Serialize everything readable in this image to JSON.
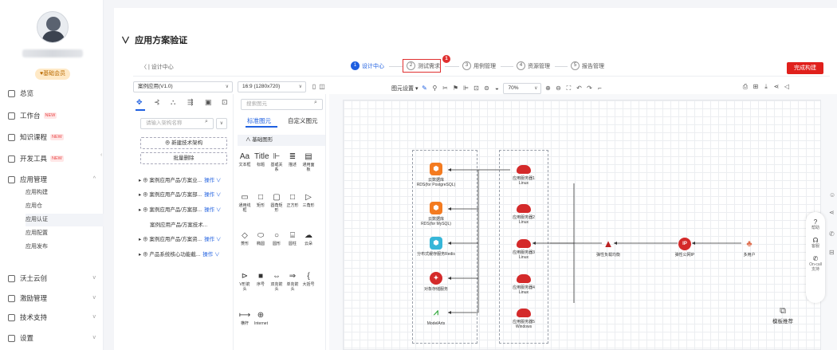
{
  "sidebar": {
    "member_badge": "♥基础会员",
    "items": [
      {
        "label": "总览",
        "icon": "overview-icon",
        "new": "",
        "chev": ""
      },
      {
        "label": "工作台",
        "icon": "workbench-icon",
        "new": "NEW",
        "chev": ""
      },
      {
        "label": "知识课程",
        "icon": "course-icon",
        "new": "NEW",
        "chev": ""
      },
      {
        "label": "开发工具",
        "icon": "devtools-icon",
        "new": "NEW",
        "chev": ""
      },
      {
        "label": "应用管理",
        "icon": "app-manage-icon",
        "new": "",
        "chev": "^"
      },
      {
        "label": "沃土云创",
        "icon": "cloud-create-icon",
        "new": "",
        "chev": "v"
      },
      {
        "label": "激励管理",
        "icon": "incentive-icon",
        "new": "",
        "chev": "v"
      },
      {
        "label": "技术支持",
        "icon": "support-icon",
        "new": "",
        "chev": "v"
      },
      {
        "label": "设置",
        "icon": "settings-icon",
        "new": "",
        "chev": "v"
      }
    ],
    "sub_items": [
      "应用构建",
      "应用仓",
      "应用认证",
      "应用配置",
      "应用发布"
    ],
    "collapse": "‹"
  },
  "page": {
    "title": "应用方案验证",
    "title_chev": "∨"
  },
  "topbar": {
    "back": "〈 | 设计中心",
    "steps": [
      {
        "num": "1",
        "label": "设计中心"
      },
      {
        "num": "2",
        "label": "测试需求"
      },
      {
        "num": "3",
        "label": "用例管理"
      },
      {
        "num": "4",
        "label": "资源管理"
      },
      {
        "num": "5",
        "label": "报告管理"
      }
    ],
    "highlight_count": "1",
    "finish_button": "完成构建"
  },
  "left_panel": {
    "project_select": "案例应用(V1.0)",
    "search_placeholder": "请输入架构名称",
    "new_arch_button": "⊕ 新建技术架构",
    "batch_delete_button": "批量删除",
    "op_label": "操作 ∨",
    "tree": [
      "▸ ⊕ 案例应用产品/方案业...",
      "▸ ⊕ 案例应用产品/方案部...",
      "▸ ⊕ 案例应用产品/方案部...",
      "案例应用产品/方案技术...",
      "▸ ⊕ 案例应用产品/方案资...",
      "▸ ⊕ 产品系统核心功能截..."
    ]
  },
  "shape_panel": {
    "size_select": "16:9 (1280x720)",
    "search_placeholder": "搜索图元",
    "tabs": [
      "标准图元",
      "自定义图元"
    ],
    "section": "∧  基础图形",
    "shapes_row1": [
      {
        "g": "Aa",
        "l": "文本框"
      },
      {
        "g": "Title",
        "l": "标题"
      },
      {
        "g": "⊩",
        "l": "基或关系"
      },
      {
        "g": "≣",
        "l": "描述"
      },
      {
        "g": "▤",
        "l": "通用面板"
      }
    ],
    "shapes_row2": [
      {
        "g": "▭",
        "l": "通用线框"
      },
      {
        "g": "□",
        "l": "矩形"
      },
      {
        "g": "▢",
        "l": "圆角矩形"
      },
      {
        "g": "□",
        "l": "正方形"
      },
      {
        "g": "▷",
        "l": "三角形"
      }
    ],
    "shapes_row3": [
      {
        "g": "◇",
        "l": "菱形"
      },
      {
        "g": "⬭",
        "l": "椭圆"
      },
      {
        "g": "○",
        "l": "圆形"
      },
      {
        "g": "⌸",
        "l": "圆柱"
      },
      {
        "g": "☁",
        "l": "云朵"
      }
    ],
    "shapes_row4": [
      {
        "g": "⊳",
        "l": "V形箭头"
      },
      {
        "g": "■",
        "l": "序号"
      },
      {
        "g": "⇔",
        "l": "双向箭头"
      },
      {
        "g": "⇒",
        "l": "单向箭头"
      },
      {
        "g": "{",
        "l": "大括号"
      }
    ],
    "shapes_row5": [
      {
        "g": "⟼",
        "l": "横杆"
      },
      {
        "g": "⊕",
        "l": "Internet"
      }
    ]
  },
  "toolbar": {
    "figure_settings": "图元设置 ▾",
    "zoom": "70%"
  },
  "diagram": {
    "db_nodes": [
      {
        "label": "云数据库\nRDS(for PostgreSQL)",
        "icon": "rds-postgres-icon"
      },
      {
        "label": "云数据库\nRDS(for MySQL)",
        "icon": "rds-mysql-icon"
      },
      {
        "label": "分布式缓存服务Redis",
        "icon": "redis-icon"
      },
      {
        "label": "对象存储服务",
        "icon": "obs-icon"
      },
      {
        "label": "ModelArts",
        "icon": "modelarts-icon"
      }
    ],
    "server_nodes": [
      {
        "label": "应用服务器1\nLinux"
      },
      {
        "label": "应用服务器2\nLinux"
      },
      {
        "label": "应用服务器3\nLinux"
      },
      {
        "label": "应用服务器4\nLinux"
      },
      {
        "label": "应用服务器5\nWindows"
      }
    ],
    "elb": "弹性负载均衡",
    "eip": "弹性公网IP",
    "eip_glyph": "IP",
    "users": "多用户"
  },
  "right_tools": [
    {
      "icon": "help-icon",
      "glyph": "?",
      "label": "帮助"
    },
    {
      "icon": "headset-icon",
      "glyph": "☊",
      "label": "客服"
    },
    {
      "icon": "oncall-icon",
      "glyph": "✆",
      "label": "On-call\n支持"
    }
  ],
  "template_recommend": "模板推荐",
  "side_icons": [
    "☺",
    "⋖",
    "✆",
    "⊟"
  ]
}
